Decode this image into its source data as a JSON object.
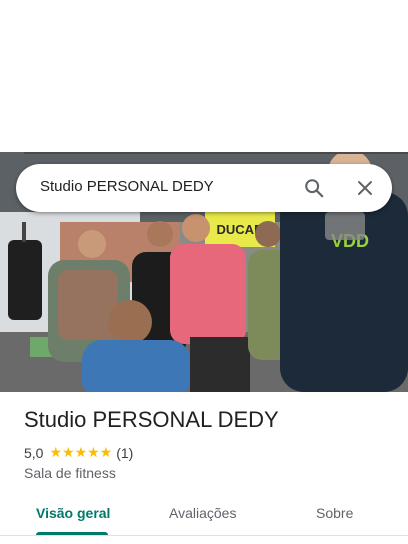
{
  "search": {
    "query": "Studio PERSONAL DEDY",
    "search_icon": "search-icon",
    "close_icon": "close-icon"
  },
  "photo": {
    "description_icon": "place-photo",
    "banner_text": "DUCAR",
    "shirt_logo": "VDD"
  },
  "place": {
    "title": "Studio PERSONAL DEDY",
    "rating": "5,0",
    "stars": "★★★★★",
    "review_count": "(1)",
    "category": "Sala de fitness"
  },
  "tabs": [
    {
      "label": "Visão geral",
      "active": true
    },
    {
      "label": "Avaliações",
      "active": false
    },
    {
      "label": "Sobre",
      "active": false
    }
  ],
  "colors": {
    "accent": "#00796b",
    "star": "#fbbc04",
    "text_primary": "#202124",
    "text_secondary": "#5f6368"
  }
}
